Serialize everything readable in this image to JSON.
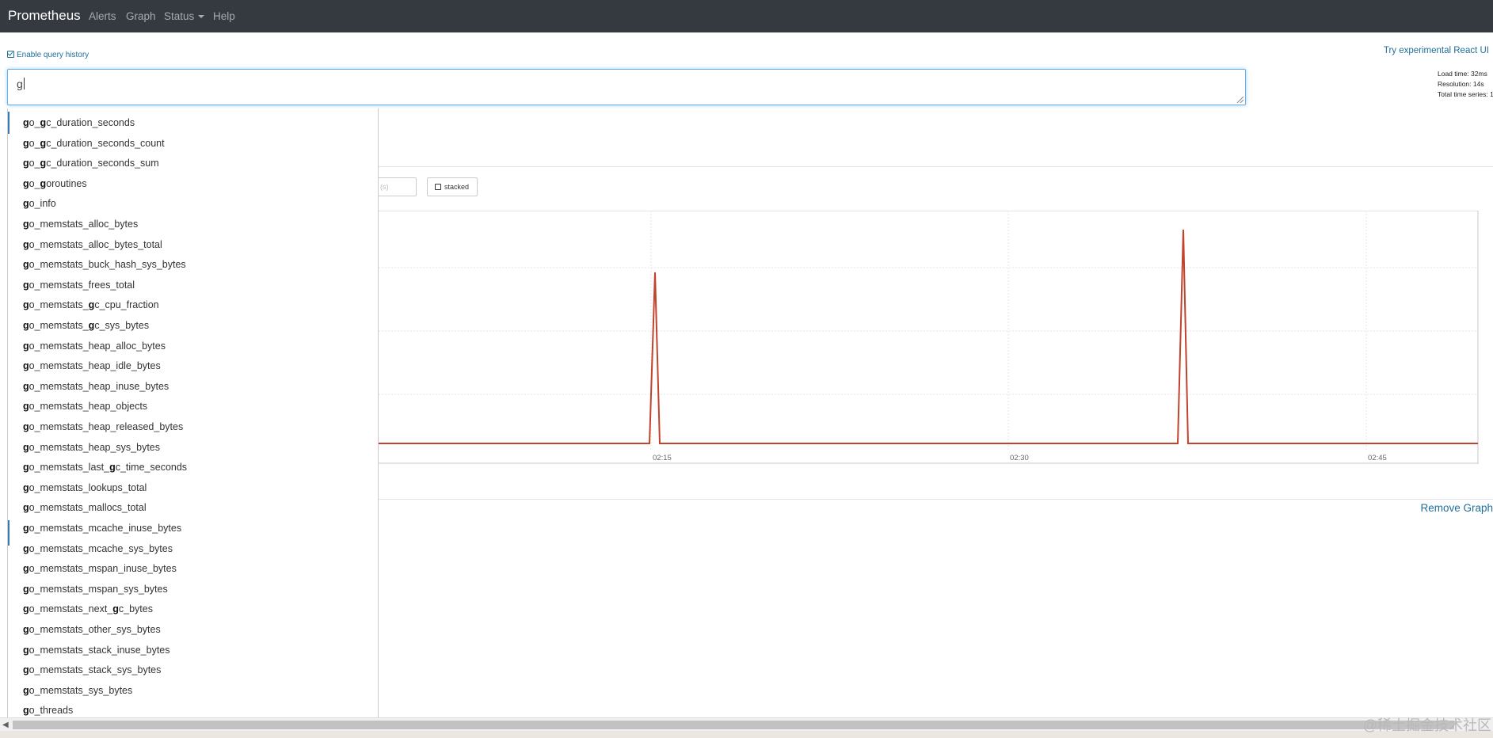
{
  "navbar": {
    "brand": "Prometheus",
    "links": [
      "Alerts",
      "Graph",
      "Status",
      "Help"
    ]
  },
  "history": {
    "label": "Enable query history"
  },
  "react_link": "Try experimental React UI",
  "stats": {
    "load_time": "Load time: 32ms",
    "resolution": "Resolution: 14s",
    "total_series": "Total time series: 1"
  },
  "query": {
    "value": "g"
  },
  "controls": {
    "res_placeholder": "(s)",
    "stacked_label": "stacked"
  },
  "chart_data": {
    "type": "line",
    "x_ticks": [
      "02:15",
      "02:30",
      "02:45"
    ],
    "series_color": "#c1432c",
    "baseline": 0,
    "peaks": [
      {
        "label": "spike before 02:15",
        "height_ratio": 0.8
      },
      {
        "label": "spike after 02:30",
        "height_ratio": 1.0
      }
    ],
    "grid": true
  },
  "remove_graph": "Remove Graph",
  "autocomplete": {
    "typed": "g",
    "items": [
      "go_gc_duration_seconds",
      "go_gc_duration_seconds_count",
      "go_gc_duration_seconds_sum",
      "go_goroutines",
      "go_info",
      "go_memstats_alloc_bytes",
      "go_memstats_alloc_bytes_total",
      "go_memstats_buck_hash_sys_bytes",
      "go_memstats_frees_total",
      "go_memstats_gc_cpu_fraction",
      "go_memstats_gc_sys_bytes",
      "go_memstats_heap_alloc_bytes",
      "go_memstats_heap_idle_bytes",
      "go_memstats_heap_inuse_bytes",
      "go_memstats_heap_objects",
      "go_memstats_heap_released_bytes",
      "go_memstats_heap_sys_bytes",
      "go_memstats_last_gc_time_seconds",
      "go_memstats_lookups_total",
      "go_memstats_mallocs_total",
      "go_memstats_mcache_inuse_bytes",
      "go_memstats_mcache_sys_bytes",
      "go_memstats_mspan_inuse_bytes",
      "go_memstats_mspan_sys_bytes",
      "go_memstats_next_gc_bytes",
      "go_memstats_other_sys_bytes",
      "go_memstats_stack_inuse_bytes",
      "go_memstats_stack_sys_bytes",
      "go_memstats_sys_bytes",
      "go_threads"
    ]
  },
  "watermark": "@稀土掘金技术社区"
}
